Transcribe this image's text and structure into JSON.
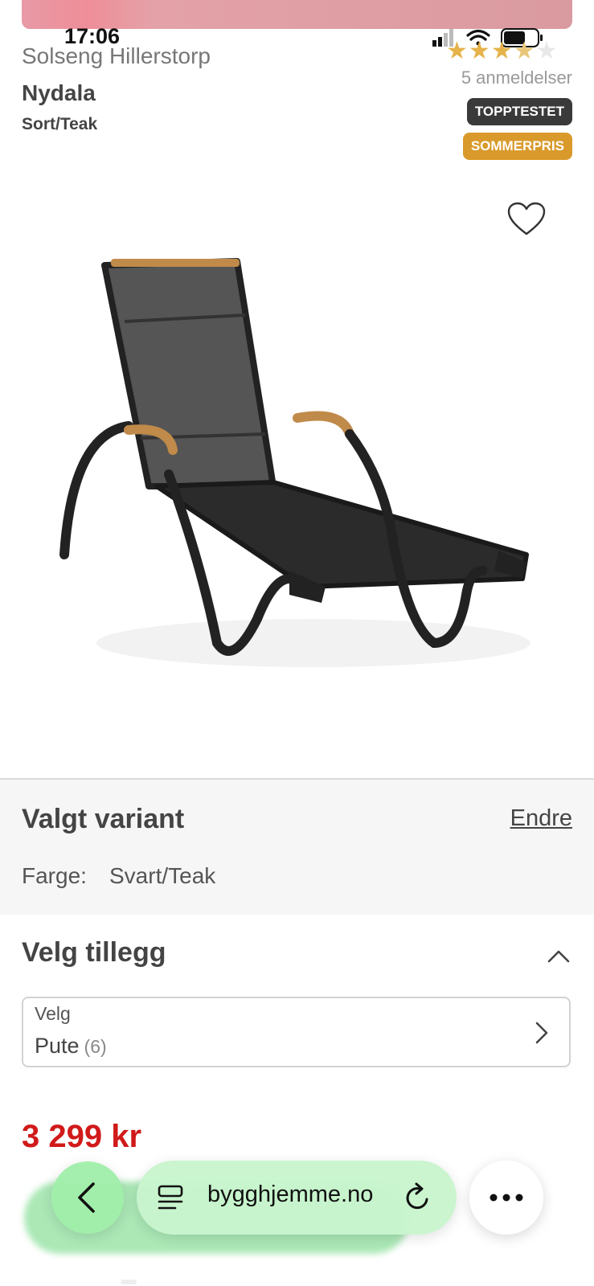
{
  "status_bar": {
    "time": "17:06"
  },
  "product": {
    "brand_line": "Solseng Hillerstorp",
    "name": "Nydala",
    "color_short": "Sort/Teak",
    "rating": 3.5,
    "rating_max": 5,
    "review_count_label": "5 anmeldelser",
    "badges": [
      "TOPPTESTET",
      "SOMMERPRIS"
    ],
    "image_alt": "chair-image"
  },
  "variant": {
    "title": "Valgt variant",
    "edit_label": "Endre",
    "color_label": "Farge:",
    "color_value": "Svart/Teak"
  },
  "addons": {
    "title": "Velg tillegg",
    "select_label": "Velg",
    "select_value": "Pute",
    "select_count": "(6)"
  },
  "price": "3 299 kr",
  "browser": {
    "url": "bygghjemme.no"
  },
  "colors": {
    "price": "#d11a1a",
    "badge_dark": "#3a3a3a",
    "badge_orange": "#d99a2b",
    "star": "#e6b24a"
  }
}
